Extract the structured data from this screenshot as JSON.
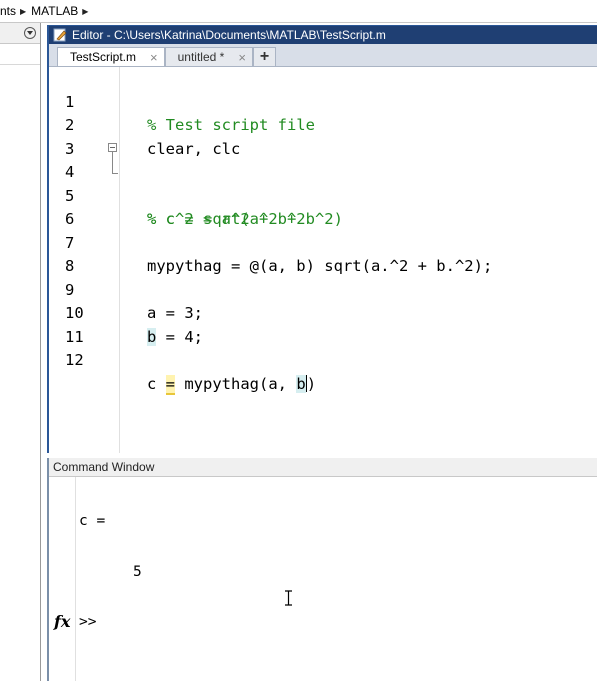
{
  "breadcrumb": {
    "items": [
      "nts",
      "MATLAB"
    ]
  },
  "editor": {
    "title": "Editor - C:\\Users\\Katrina\\Documents\\MATLAB\\TestScript.m",
    "tabs": [
      {
        "label": "TestScript.m",
        "active": true,
        "close": "×"
      },
      {
        "label": "untitled *",
        "active": false,
        "close": "×"
      }
    ],
    "add_tab": "+",
    "lines": [
      {
        "no": "1",
        "text": "% Test script file"
      },
      {
        "no": "2",
        "text": "clear, clc"
      },
      {
        "no": "3",
        "text": ""
      },
      {
        "no": "4",
        "text": "% c^2 = a^2 + b^2"
      },
      {
        "no": "5",
        "text": "% c = sqrt(a^2 + b^2)"
      },
      {
        "no": "6",
        "text": ""
      },
      {
        "no": "7",
        "text": "mypythag = @(a, b) sqrt(a.^2 + b.^2);"
      },
      {
        "no": "8",
        "text": ""
      },
      {
        "no": "9",
        "text": "a = 3;"
      },
      {
        "no": "10",
        "text": "b = 4;"
      },
      {
        "no": "11",
        "text": ""
      },
      {
        "no": "12",
        "text": "c = mypythag(a, b)"
      }
    ],
    "line10_parts": {
      "var": "b",
      "rest": " = 4;"
    },
    "line12_parts": {
      "pre": "c ",
      "eq": "=",
      "mid": " mypythag(a, ",
      "b": "b",
      "post": ")"
    }
  },
  "command_window": {
    "title": "Command Window",
    "output_var": "c =",
    "output_value": "5",
    "prompt_icon": "fx",
    "prompt": ">>"
  },
  "colors": {
    "comment": "#228b22",
    "titlebar": "#1f3f73"
  }
}
